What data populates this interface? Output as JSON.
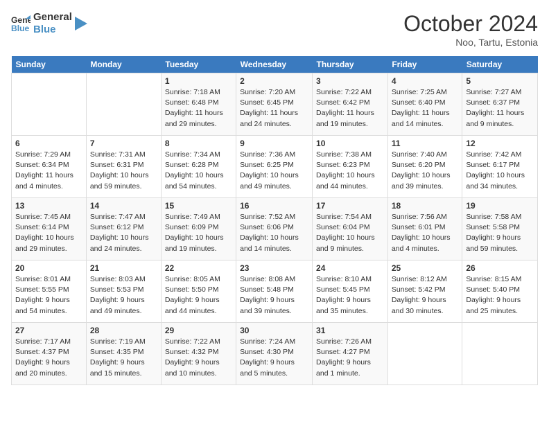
{
  "logo": {
    "line1": "General",
    "line2": "Blue"
  },
  "title": "October 2024",
  "location": "Noo, Tartu, Estonia",
  "days_of_week": [
    "Sunday",
    "Monday",
    "Tuesday",
    "Wednesday",
    "Thursday",
    "Friday",
    "Saturday"
  ],
  "weeks": [
    [
      {
        "day": "",
        "info": ""
      },
      {
        "day": "",
        "info": ""
      },
      {
        "day": "1",
        "info": "Sunrise: 7:18 AM\nSunset: 6:48 PM\nDaylight: 11 hours and 29 minutes."
      },
      {
        "day": "2",
        "info": "Sunrise: 7:20 AM\nSunset: 6:45 PM\nDaylight: 11 hours and 24 minutes."
      },
      {
        "day": "3",
        "info": "Sunrise: 7:22 AM\nSunset: 6:42 PM\nDaylight: 11 hours and 19 minutes."
      },
      {
        "day": "4",
        "info": "Sunrise: 7:25 AM\nSunset: 6:40 PM\nDaylight: 11 hours and 14 minutes."
      },
      {
        "day": "5",
        "info": "Sunrise: 7:27 AM\nSunset: 6:37 PM\nDaylight: 11 hours and 9 minutes."
      }
    ],
    [
      {
        "day": "6",
        "info": "Sunrise: 7:29 AM\nSunset: 6:34 PM\nDaylight: 11 hours and 4 minutes."
      },
      {
        "day": "7",
        "info": "Sunrise: 7:31 AM\nSunset: 6:31 PM\nDaylight: 10 hours and 59 minutes."
      },
      {
        "day": "8",
        "info": "Sunrise: 7:34 AM\nSunset: 6:28 PM\nDaylight: 10 hours and 54 minutes."
      },
      {
        "day": "9",
        "info": "Sunrise: 7:36 AM\nSunset: 6:25 PM\nDaylight: 10 hours and 49 minutes."
      },
      {
        "day": "10",
        "info": "Sunrise: 7:38 AM\nSunset: 6:23 PM\nDaylight: 10 hours and 44 minutes."
      },
      {
        "day": "11",
        "info": "Sunrise: 7:40 AM\nSunset: 6:20 PM\nDaylight: 10 hours and 39 minutes."
      },
      {
        "day": "12",
        "info": "Sunrise: 7:42 AM\nSunset: 6:17 PM\nDaylight: 10 hours and 34 minutes."
      }
    ],
    [
      {
        "day": "13",
        "info": "Sunrise: 7:45 AM\nSunset: 6:14 PM\nDaylight: 10 hours and 29 minutes."
      },
      {
        "day": "14",
        "info": "Sunrise: 7:47 AM\nSunset: 6:12 PM\nDaylight: 10 hours and 24 minutes."
      },
      {
        "day": "15",
        "info": "Sunrise: 7:49 AM\nSunset: 6:09 PM\nDaylight: 10 hours and 19 minutes."
      },
      {
        "day": "16",
        "info": "Sunrise: 7:52 AM\nSunset: 6:06 PM\nDaylight: 10 hours and 14 minutes."
      },
      {
        "day": "17",
        "info": "Sunrise: 7:54 AM\nSunset: 6:04 PM\nDaylight: 10 hours and 9 minutes."
      },
      {
        "day": "18",
        "info": "Sunrise: 7:56 AM\nSunset: 6:01 PM\nDaylight: 10 hours and 4 minutes."
      },
      {
        "day": "19",
        "info": "Sunrise: 7:58 AM\nSunset: 5:58 PM\nDaylight: 9 hours and 59 minutes."
      }
    ],
    [
      {
        "day": "20",
        "info": "Sunrise: 8:01 AM\nSunset: 5:55 PM\nDaylight: 9 hours and 54 minutes."
      },
      {
        "day": "21",
        "info": "Sunrise: 8:03 AM\nSunset: 5:53 PM\nDaylight: 9 hours and 49 minutes."
      },
      {
        "day": "22",
        "info": "Sunrise: 8:05 AM\nSunset: 5:50 PM\nDaylight: 9 hours and 44 minutes."
      },
      {
        "day": "23",
        "info": "Sunrise: 8:08 AM\nSunset: 5:48 PM\nDaylight: 9 hours and 39 minutes."
      },
      {
        "day": "24",
        "info": "Sunrise: 8:10 AM\nSunset: 5:45 PM\nDaylight: 9 hours and 35 minutes."
      },
      {
        "day": "25",
        "info": "Sunrise: 8:12 AM\nSunset: 5:42 PM\nDaylight: 9 hours and 30 minutes."
      },
      {
        "day": "26",
        "info": "Sunrise: 8:15 AM\nSunset: 5:40 PM\nDaylight: 9 hours and 25 minutes."
      }
    ],
    [
      {
        "day": "27",
        "info": "Sunrise: 7:17 AM\nSunset: 4:37 PM\nDaylight: 9 hours and 20 minutes."
      },
      {
        "day": "28",
        "info": "Sunrise: 7:19 AM\nSunset: 4:35 PM\nDaylight: 9 hours and 15 minutes."
      },
      {
        "day": "29",
        "info": "Sunrise: 7:22 AM\nSunset: 4:32 PM\nDaylight: 9 hours and 10 minutes."
      },
      {
        "day": "30",
        "info": "Sunrise: 7:24 AM\nSunset: 4:30 PM\nDaylight: 9 hours and 5 minutes."
      },
      {
        "day": "31",
        "info": "Sunrise: 7:26 AM\nSunset: 4:27 PM\nDaylight: 9 hours and 1 minute."
      },
      {
        "day": "",
        "info": ""
      },
      {
        "day": "",
        "info": ""
      }
    ]
  ]
}
